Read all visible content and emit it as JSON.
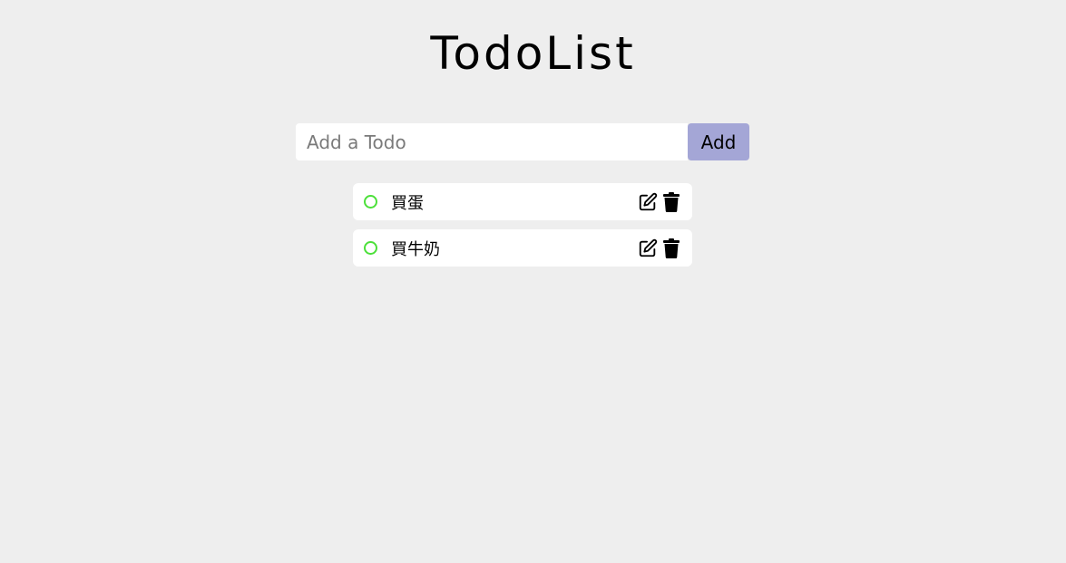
{
  "app": {
    "title": "TodoList"
  },
  "form": {
    "placeholder": "Add a Todo",
    "value": "",
    "add_label": "Add"
  },
  "todos": [
    {
      "text": "買蛋",
      "status_icon": "circle-outline-icon",
      "edit_icon": "edit-icon",
      "delete_icon": "trash-icon"
    },
    {
      "text": "買牛奶",
      "status_icon": "circle-outline-icon",
      "edit_icon": "edit-icon",
      "delete_icon": "trash-icon"
    }
  ],
  "colors": {
    "background": "#eeeeee",
    "accent_button": "#a4a6d6",
    "status_circle": "#4ce03a"
  }
}
